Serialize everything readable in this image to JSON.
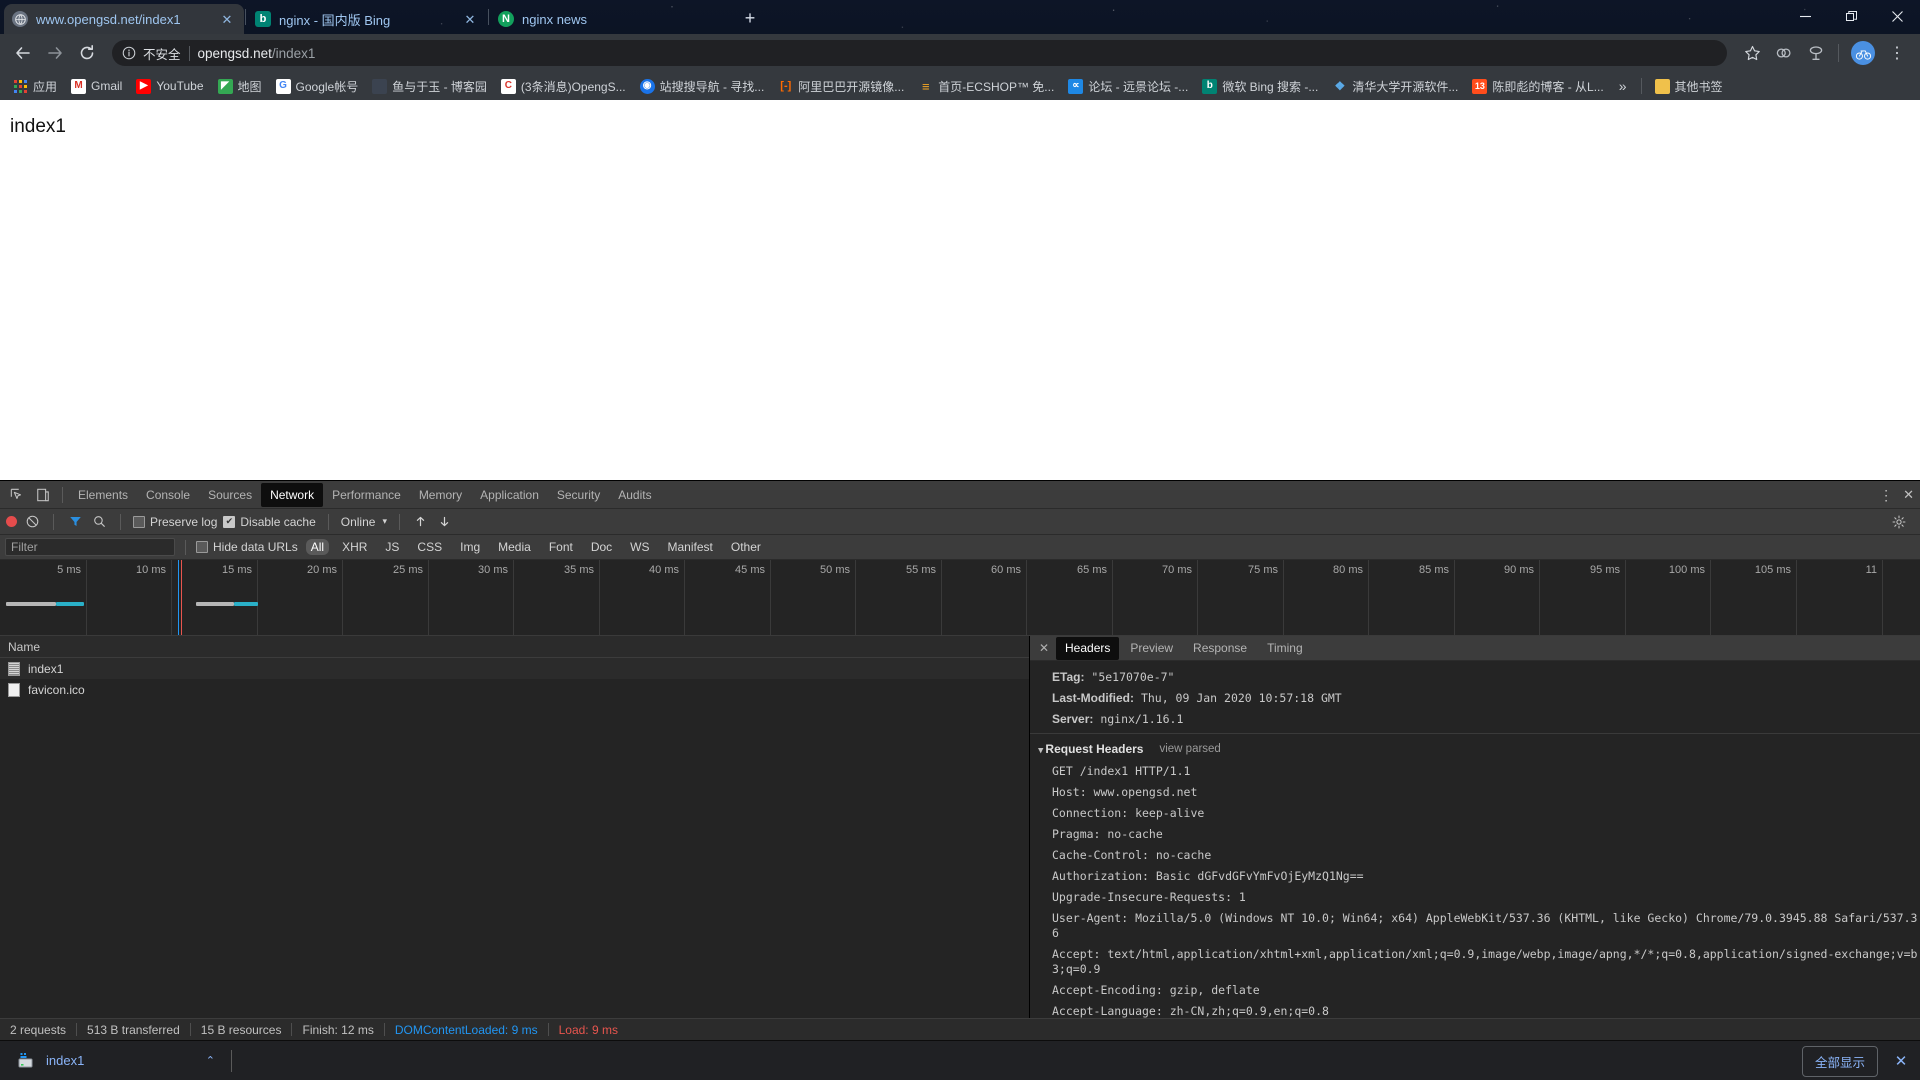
{
  "window": {
    "minimize_label": "minimize-window",
    "maximize_label": "restore-window",
    "close_label": "close-window"
  },
  "tabs": [
    {
      "title": "www.opengsd.net/index1",
      "favicon": "globe-icon",
      "active": true,
      "close": "✕"
    },
    {
      "title": "nginx - 国内版 Bing",
      "favicon": "bing-icon",
      "active": false,
      "close": "✕"
    },
    {
      "title": "nginx news",
      "favicon": "nginx-icon",
      "active": false,
      "close": "✕"
    }
  ],
  "new_tab_label": "+",
  "toolbar": {
    "back": "←",
    "forward": "→",
    "reload": "⟳",
    "security_text": "不安全",
    "url_host": "opengsd.net",
    "url_path": "/index1",
    "bookmark_star": "☆",
    "extension_1": "extensions-icon",
    "extension_2": "cast-icon",
    "menu": "⋮"
  },
  "bookmarks": {
    "apps_label": "应用",
    "items": [
      {
        "label": "Gmail",
        "icon": "M",
        "color": "#d93025",
        "bg": "#ffffff"
      },
      {
        "label": "YouTube",
        "icon": "▶",
        "color": "#ffffff",
        "bg": "#ff0000"
      },
      {
        "label": "地图",
        "icon": "◤",
        "color": "#ffffff",
        "bg": "#34a853"
      },
      {
        "label": "Google帐号",
        "icon": "G",
        "color": "#4285f4",
        "bg": "#ffffff"
      },
      {
        "label": "鱼与于玉 - 博客园",
        "icon": "",
        "color": "#ffffff",
        "bg": "#2a2f36"
      },
      {
        "label": "(3条消息)OpengS...",
        "icon": "C",
        "color": "#ffffff",
        "bg": "#d9352c"
      },
      {
        "label": "站搜搜导航 - 寻找...",
        "icon": "◉",
        "color": "#ffffff",
        "bg": "#1a73e8"
      },
      {
        "label": "阿里巴巴开源镜像...",
        "icon": "[-]",
        "color": "#ffffff",
        "bg": "#ff6a00"
      },
      {
        "label": "首页-ECSHOP™ 免...",
        "icon": "≡",
        "color": "#ffffff",
        "bg": "#f5a623"
      },
      {
        "label": "论坛 - 远景论坛 -...",
        "icon": "∝",
        "color": "#ffffff",
        "bg": "#1e88e5"
      },
      {
        "label": "微软 Bing 搜索 -...",
        "icon": "b",
        "color": "#ffffff",
        "bg": "#008373"
      },
      {
        "label": "清华大学开源软件...",
        "icon": "❖",
        "color": "#ffffff",
        "bg": "#5aa9e6"
      },
      {
        "label": "陈即彪的博客 - 从L...",
        "icon": "13",
        "color": "#ffffff",
        "bg": "#ff4d1c"
      }
    ],
    "overflow": "»",
    "other_bookmarks": "其他书签",
    "other_icon": "folder-icon"
  },
  "page": {
    "body_text": "index1"
  },
  "devtools": {
    "inspect_icon": "inspect-element-icon",
    "device_icon": "device-toolbar-icon",
    "tabs": [
      {
        "label": "Elements",
        "active": false
      },
      {
        "label": "Console",
        "active": false
      },
      {
        "label": "Sources",
        "active": false
      },
      {
        "label": "Network",
        "active": true
      },
      {
        "label": "Performance",
        "active": false
      },
      {
        "label": "Memory",
        "active": false
      },
      {
        "label": "Application",
        "active": false
      },
      {
        "label": "Security",
        "active": false
      },
      {
        "label": "Audits",
        "active": false
      }
    ],
    "more_tools": "⋮",
    "close": "✕",
    "network_toolbar": {
      "record_label": "record-button",
      "clear_label": "clear-button",
      "filter_label": "filter-button",
      "search_label": "search-button",
      "preserve_log": "Preserve log",
      "preserve_log_checked": false,
      "disable_cache": "Disable cache",
      "disable_cache_checked": true,
      "throttle_value": "Online",
      "throttle_caret": "▾",
      "import_label": "import-har-button",
      "export_label": "export-har-button",
      "settings_label": "settings-gear-icon"
    },
    "filter_bar": {
      "filter_placeholder": "Filter",
      "filter_value": "",
      "hide_data_urls": "Hide data URLs",
      "hide_data_urls_checked": false,
      "types": [
        "All",
        "XHR",
        "JS",
        "CSS",
        "Img",
        "Media",
        "Font",
        "Doc",
        "WS",
        "Manifest",
        "Other"
      ],
      "active_type": "All"
    },
    "overview": {
      "tick_labels": [
        "5 ms",
        "10 ms",
        "15 ms",
        "20 ms",
        "25 ms",
        "30 ms",
        "35 ms",
        "40 ms",
        "45 ms",
        "50 ms",
        "55 ms",
        "60 ms",
        "65 ms",
        "70 ms",
        "75 ms",
        "80 ms",
        "85 ms",
        "90 ms",
        "95 ms",
        "100 ms",
        "105 ms",
        "11"
      ],
      "dcl_color": "#2196f3",
      "load_color": "#e8554e"
    },
    "request_table": {
      "column_name": "Name",
      "rows": [
        {
          "name": "index1",
          "icon": "document-icon"
        },
        {
          "name": "favicon.ico",
          "icon": "blank-file-icon"
        }
      ]
    },
    "details": {
      "tabs": [
        {
          "label": "Headers",
          "active": true
        },
        {
          "label": "Preview",
          "active": false
        },
        {
          "label": "Response",
          "active": false
        },
        {
          "label": "Timing",
          "active": false
        }
      ],
      "close": "✕",
      "response_headers_visible": [
        {
          "name": "ETag:",
          "value": "\"5e17070e-7\""
        },
        {
          "name": "Last-Modified:",
          "value": "Thu, 09 Jan 2020 10:57:18 GMT"
        },
        {
          "name": "Server:",
          "value": "nginx/1.16.1"
        }
      ],
      "request_section": {
        "caret": "▼",
        "title": "Request Headers",
        "link": "view parsed"
      },
      "request_headers": [
        {
          "name": "",
          "value": "GET /index1 HTTP/1.1"
        },
        {
          "name": "",
          "value": "Host: www.opengsd.net"
        },
        {
          "name": "",
          "value": "Connection: keep-alive"
        },
        {
          "name": "",
          "value": "Pragma: no-cache"
        },
        {
          "name": "",
          "value": "Cache-Control: no-cache"
        },
        {
          "name": "",
          "value": "Authorization: Basic dGFvdGFvYmFvOjEyMzQ1Ng=="
        },
        {
          "name": "",
          "value": "Upgrade-Insecure-Requests: 1"
        },
        {
          "name": "",
          "value": "User-Agent: Mozilla/5.0 (Windows NT 10.0; Win64; x64) AppleWebKit/537.36 (KHTML, like Gecko) Chrome/79.0.3945.88 Safari/537.36"
        },
        {
          "name": "",
          "value": "Accept: text/html,application/xhtml+xml,application/xml;q=0.9,image/webp,image/apng,*/*;q=0.8,application/signed-exchange;v=b3;q=0.9"
        },
        {
          "name": "",
          "value": "Accept-Encoding: gzip, deflate"
        },
        {
          "name": "",
          "value": "Accept-Language: zh-CN,zh;q=0.9,en;q=0.8"
        }
      ]
    },
    "status": {
      "requests": "2 requests",
      "transferred": "513 B transferred",
      "resources": "15 B resources",
      "finish": "Finish: 12 ms",
      "dom_content_loaded": "DOMContentLoaded: 9 ms",
      "load": "Load: 9 ms"
    }
  },
  "download_shelf": {
    "file_name": "index1",
    "file_icon": "installer-file-icon",
    "caret": "⌃",
    "show_all": "全部显示",
    "close": "✕"
  }
}
